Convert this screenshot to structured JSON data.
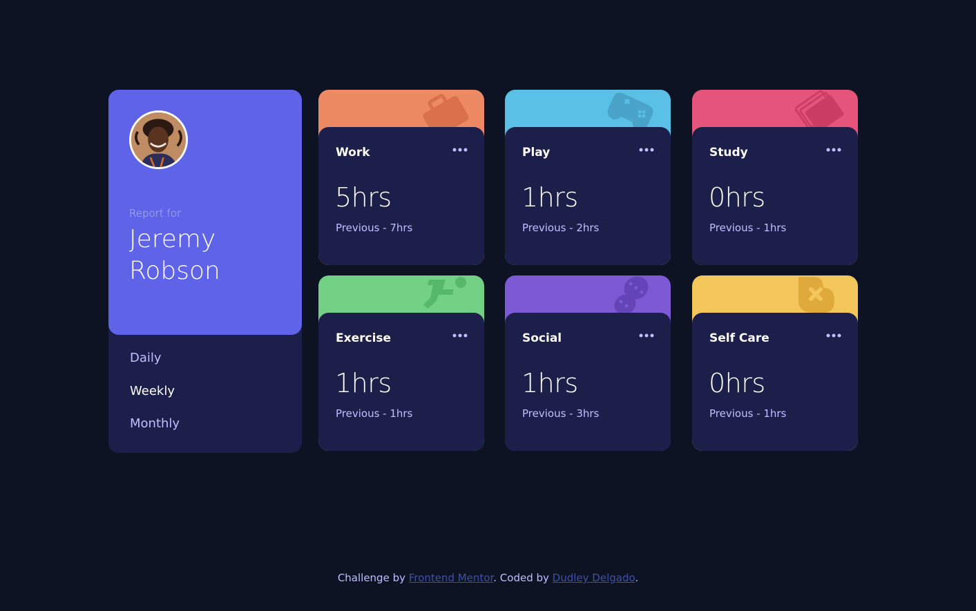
{
  "profile": {
    "report_for": "Report for",
    "name": "Jeremy Robson"
  },
  "periods": [
    "Daily",
    "Weekly",
    "Monthly"
  ],
  "cards": [
    {
      "title": "Work",
      "current": "5hrs",
      "previous": "Previous - 7hrs",
      "color": "#ed8a64",
      "icon": "briefcase-icon"
    },
    {
      "title": "Play",
      "current": "1hrs",
      "previous": "Previous - 2hrs",
      "color": "#5bc0e6",
      "icon": "gamepad-icon"
    },
    {
      "title": "Study",
      "current": "0hrs",
      "previous": "Previous - 1hrs",
      "color": "#e5557b",
      "icon": "books-icon"
    },
    {
      "title": "Exercise",
      "current": "1hrs",
      "previous": "Previous - 1hrs",
      "color": "#72d184",
      "icon": "running-icon"
    },
    {
      "title": "Social",
      "current": "1hrs",
      "previous": "Previous - 3hrs",
      "color": "#7b5ad3",
      "icon": "chat-icon"
    },
    {
      "title": "Self Care",
      "current": "0hrs",
      "previous": "Previous - 1hrs",
      "color": "#f2c65b",
      "icon": "heart-icon"
    }
  ],
  "footer": {
    "prefix": "Challenge by",
    "link1": "Frontend Mentor",
    "middle": ". Coded by",
    "link2": "Dudley Delgado",
    "suffix": "."
  }
}
